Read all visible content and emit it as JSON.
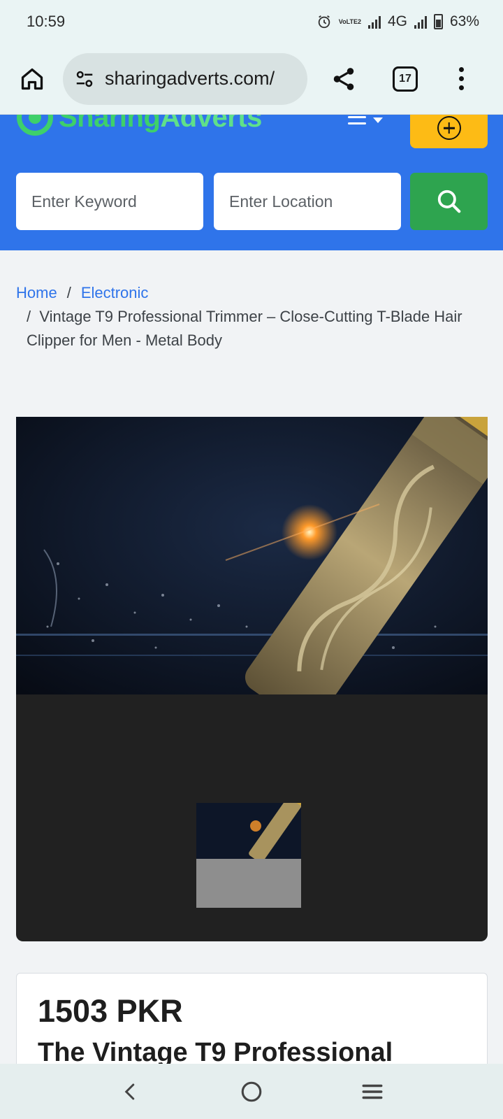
{
  "status_bar": {
    "time": "10:59",
    "network": "4G",
    "lte_label": "VoLTE2",
    "battery": "63%"
  },
  "browser": {
    "url": "sharingadverts.com/",
    "tab_count": "17"
  },
  "site": {
    "logo_part1": "Sharing",
    "logo_part2": "Adverts",
    "search": {
      "keyword_placeholder": "Enter Keyword",
      "location_placeholder": "Enter Location"
    }
  },
  "breadcrumb": {
    "home": "Home",
    "category": "Electronic",
    "separator": "/",
    "current": "Vintage T9 Professional Trimmer – Close-Cutting T-Blade Hair Clipper for Men - Metal Body"
  },
  "listing": {
    "price": "1503 PKR",
    "title_start": "The Vintage T9 Professional"
  },
  "icons": {
    "home": "home-icon",
    "site_settings": "tune-icon",
    "share": "share-icon",
    "tabs": "tabs-icon",
    "more": "more-vert-icon",
    "menu": "menu-icon",
    "post_ad": "plus-circle-icon",
    "search": "search-icon",
    "back": "back-icon",
    "home_nav": "home-circle-icon",
    "recents": "recents-icon"
  },
  "colors": {
    "header_blue": "#2f74ea",
    "post_yellow": "#fdbb15",
    "search_green": "#2ea44f",
    "logo_green": "#3ed06a",
    "link_blue": "#2f74ea"
  }
}
